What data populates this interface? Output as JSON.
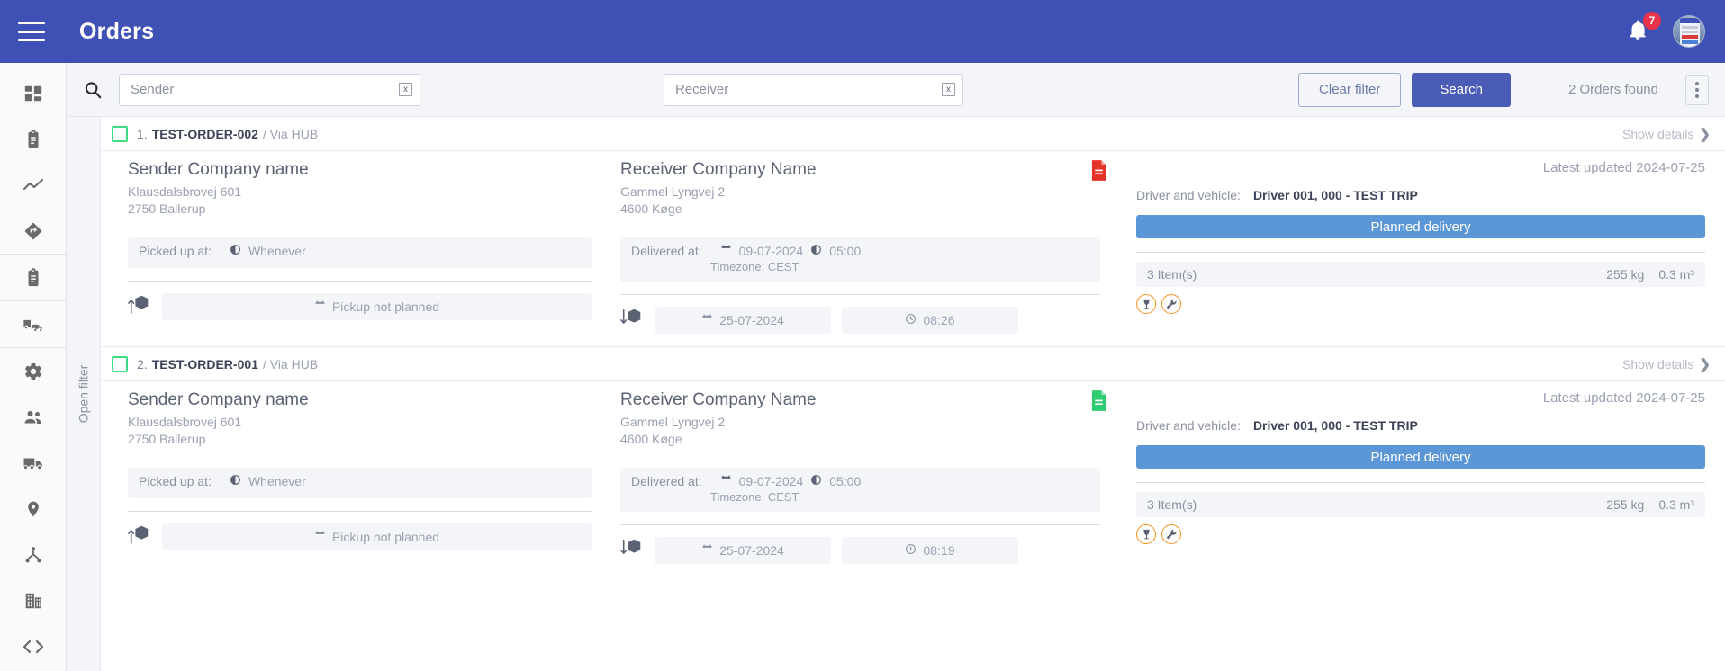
{
  "header": {
    "title": "Orders",
    "menu_icon": "hamburger-icon",
    "notification_icon": "bell-icon",
    "notification_count": "7",
    "avatar_icon": "user-avatar"
  },
  "sidebar": {
    "items": [
      {
        "name": "dashboard",
        "icon": "dashboard-grid-icon"
      },
      {
        "name": "orders",
        "icon": "clipboard-list-icon"
      },
      {
        "name": "statistics",
        "icon": "line-chart-icon"
      },
      {
        "name": "routes",
        "icon": "directions-icon"
      },
      {
        "name": "tasks",
        "icon": "clipboard-icon"
      },
      {
        "name": "fleet",
        "icon": "truck-car-icon"
      },
      {
        "name": "settings",
        "icon": "gear-icon"
      },
      {
        "name": "users",
        "icon": "people-icon"
      },
      {
        "name": "vehicles",
        "icon": "delivery-truck-icon"
      },
      {
        "name": "locations",
        "icon": "map-pin-icon"
      },
      {
        "name": "hierarchy",
        "icon": "sitemap-icon"
      },
      {
        "name": "companies",
        "icon": "building-icon"
      },
      {
        "name": "developer",
        "icon": "code-brackets-icon"
      }
    ]
  },
  "filterbar": {
    "search_icon": "search-icon",
    "sender": {
      "value": "",
      "placeholder": "Sender",
      "clear_label": "x"
    },
    "receiver": {
      "value": "",
      "placeholder": "Receiver",
      "clear_label": "x"
    },
    "clear_filter_label": "Clear filter",
    "search_label": "Search",
    "results_label": "2 Orders found",
    "more_menu_icon": "kebab-menu-icon",
    "open_filter_label": "Open filter",
    "accent_color": "#4a5cb5"
  },
  "orders": [
    {
      "index": "1.",
      "id": "TEST-ORDER-002",
      "via": "/ Via HUB",
      "show_details_label": "Show details",
      "document_icon": "document-icon",
      "document_color": "#e5332a",
      "sender": {
        "company": "Sender Company name",
        "street": "Klausdalsbrovej 601",
        "city": "2750 Ballerup",
        "picked_label": "Picked up at:",
        "picked_value": "Whenever"
      },
      "receiver": {
        "company": "Receiver Company Name",
        "street": "Gammel Lyngvej 2",
        "city": "4600 Køge",
        "delivered_label": "Delivered at:",
        "delivered_date": "09-07-2024",
        "delivered_time": "05:00",
        "timezone": "Timezone: CEST"
      },
      "pickup": {
        "label": "Pickup not planned"
      },
      "delivery": {
        "date": "25-07-2024",
        "time": "08:26"
      },
      "latest_updated": "Latest updated 2024-07-25",
      "driver_label": "Driver and vehicle:",
      "driver_value": "Driver 001, 000 - TEST TRIP",
      "status_label": "Planned delivery",
      "status_color": "#5b96d6",
      "items_label": "3 Item(s)",
      "weight": "255 kg",
      "volume": "0.3 m³",
      "flags": [
        {
          "name": "fragile-icon"
        },
        {
          "name": "wrench-icon"
        }
      ]
    },
    {
      "index": "2.",
      "id": "TEST-ORDER-001",
      "via": "/ Via HUB",
      "show_details_label": "Show details",
      "document_icon": "document-icon",
      "document_color": "#2ecc71",
      "sender": {
        "company": "Sender Company name",
        "street": "Klausdalsbrovej 601",
        "city": "2750 Ballerup",
        "picked_label": "Picked up at:",
        "picked_value": "Whenever"
      },
      "receiver": {
        "company": "Receiver Company Name",
        "street": "Gammel Lyngvej 2",
        "city": "4600 Køge",
        "delivered_label": "Delivered at:",
        "delivered_date": "09-07-2024",
        "delivered_time": "05:00",
        "timezone": "Timezone: CEST"
      },
      "pickup": {
        "label": "Pickup not planned"
      },
      "delivery": {
        "date": "25-07-2024",
        "time": "08:19"
      },
      "latest_updated": "Latest updated 2024-07-25",
      "driver_label": "Driver and vehicle:",
      "driver_value": "Driver 001, 000 - TEST TRIP",
      "status_label": "Planned delivery",
      "status_color": "#5b96d6",
      "items_label": "3 Item(s)",
      "weight": "255 kg",
      "volume": "0.3 m³",
      "flags": [
        {
          "name": "fragile-icon"
        },
        {
          "name": "wrench-icon"
        }
      ]
    }
  ]
}
